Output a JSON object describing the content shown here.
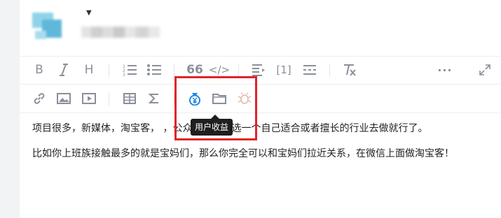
{
  "toolbar": {
    "tooltip": "用户收益",
    "bold": "B",
    "italic": "I",
    "heading": "H",
    "quote": "66",
    "code": "</>",
    "footnote": "[1]",
    "more": "···"
  },
  "content": {
    "paragraph1": "项目很多，新媒体，淘宝客，    ，公众号等等。选一个自己适合或者擅长的行业去做就行了。",
    "paragraph2": "比如你上班族接触最多的就是宝妈们，那么你完全可以和宝妈们拉近关系，在微信上面做淘宝客！"
  },
  "colors": {
    "accent": "#1e88e5",
    "highlight": "#e0242b",
    "icon": "#8a8f99"
  }
}
